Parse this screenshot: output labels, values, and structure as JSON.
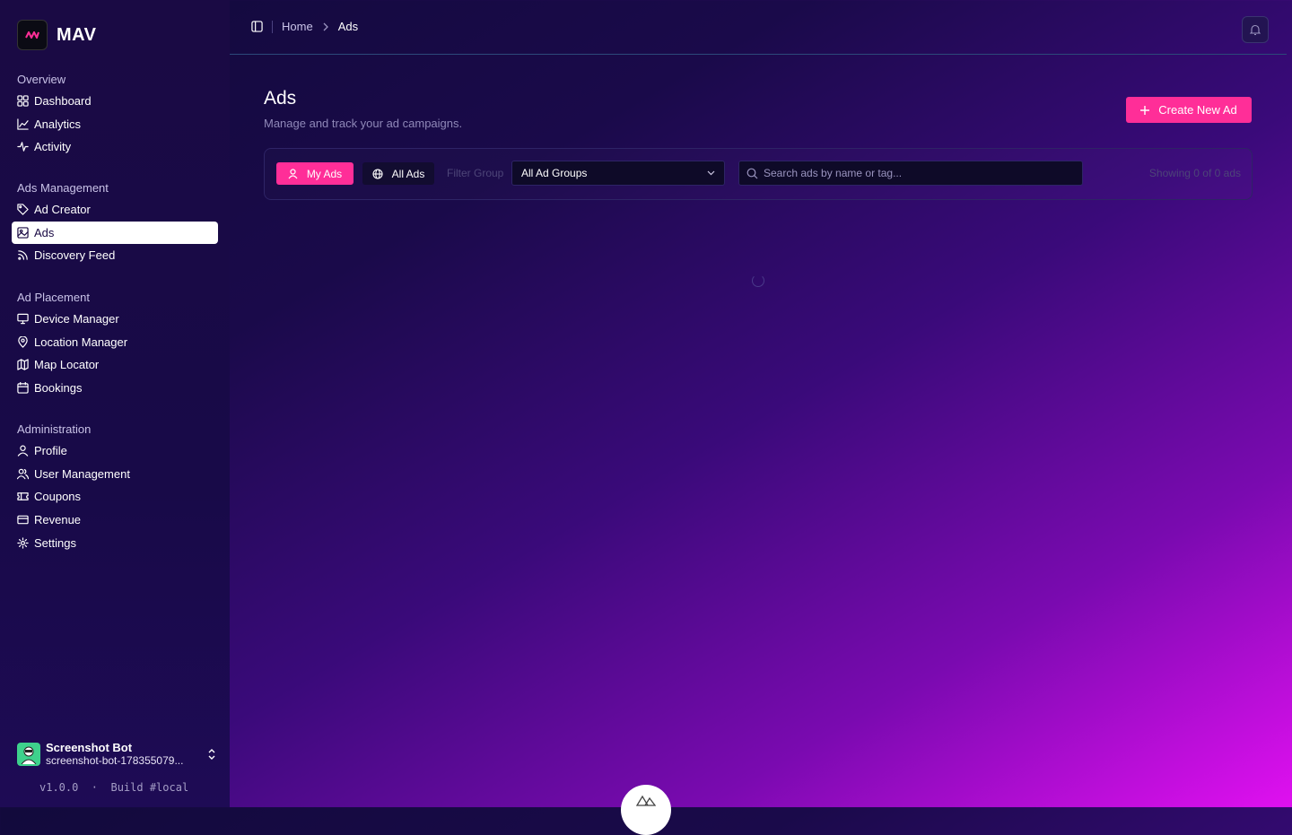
{
  "brand": {
    "name": "MAV"
  },
  "sidebar": {
    "groups": [
      {
        "title": "Overview",
        "items": [
          {
            "label": "Dashboard",
            "icon": "dashboard-icon"
          },
          {
            "label": "Analytics",
            "icon": "line-chart-icon"
          },
          {
            "label": "Activity",
            "icon": "activity-icon"
          }
        ]
      },
      {
        "title": "Ads Management",
        "items": [
          {
            "label": "Ad Creator",
            "icon": "tag-icon"
          },
          {
            "label": "Ads",
            "icon": "image-icon",
            "active": true
          },
          {
            "label": "Discovery Feed",
            "icon": "rss-icon"
          }
        ]
      },
      {
        "title": "Ad Placement",
        "items": [
          {
            "label": "Device Manager",
            "icon": "monitor-icon"
          },
          {
            "label": "Location Manager",
            "icon": "map-pin-icon"
          },
          {
            "label": "Map Locator",
            "icon": "map-icon"
          },
          {
            "label": "Bookings",
            "icon": "calendar-icon"
          }
        ]
      },
      {
        "title": "Administration",
        "items": [
          {
            "label": "Profile",
            "icon": "user-icon"
          },
          {
            "label": "User Management",
            "icon": "users-icon"
          },
          {
            "label": "Coupons",
            "icon": "ticket-icon"
          },
          {
            "label": "Revenue",
            "icon": "credit-card-icon"
          },
          {
            "label": "Settings",
            "icon": "gear-icon"
          }
        ]
      }
    ]
  },
  "user": {
    "name": "Screenshot Bot",
    "email": "screenshot-bot-178355079..."
  },
  "footer": {
    "version": "v1.0.0  ·  Build #local"
  },
  "header": {
    "breadcrumb_home": "Home",
    "breadcrumb_current": "Ads"
  },
  "page": {
    "title": "Ads",
    "subtitle": "Manage and track your ad campaigns.",
    "create_label": "Create New Ad"
  },
  "filters": {
    "my_ads_label": "My Ads",
    "all_ads_label": "All Ads",
    "group_label": "Filter Group",
    "group_selected": "All Ad Groups",
    "search_placeholder": "Search ads by name or tag...",
    "showing_text": "Showing 0 of 0 ads"
  },
  "colors": {
    "accent": "#ff2e98",
    "sidebar_bg": "#1a0a44"
  }
}
